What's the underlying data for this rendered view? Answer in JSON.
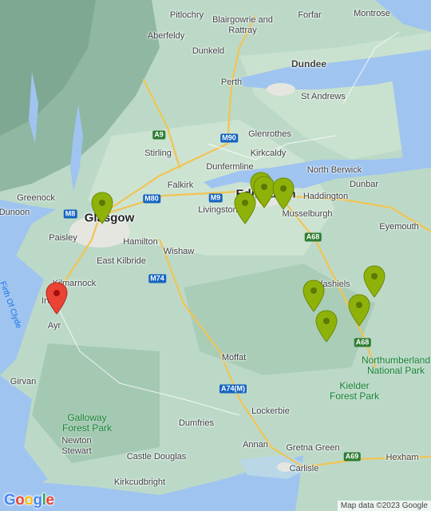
{
  "map": {
    "places": [
      {
        "id": "pitlochry",
        "label": "Pitlochry"
      },
      {
        "id": "blairgowrie",
        "label": "Blairgowrie and Rattray"
      },
      {
        "id": "forfar",
        "label": "Forfar"
      },
      {
        "id": "montrose",
        "label": "Montrose"
      },
      {
        "id": "aberfeldy",
        "label": "Aberfeldy"
      },
      {
        "id": "dunkeld",
        "label": "Dunkeld"
      },
      {
        "id": "dundee",
        "label": "Dundee"
      },
      {
        "id": "perth",
        "label": "Perth"
      },
      {
        "id": "standrews",
        "label": "St Andrews"
      },
      {
        "id": "glenrothes",
        "label": "Glenrothes"
      },
      {
        "id": "stirling",
        "label": "Stirling"
      },
      {
        "id": "kirkcaldy",
        "label": "Kirkcaldy"
      },
      {
        "id": "dunfermline",
        "label": "Dunfermline"
      },
      {
        "id": "northberwick",
        "label": "North Berwick"
      },
      {
        "id": "falkirk",
        "label": "Falkirk"
      },
      {
        "id": "dunbar",
        "label": "Dunbar"
      },
      {
        "id": "greenock",
        "label": "Greenock"
      },
      {
        "id": "edinburgh",
        "label": "Edinburgh"
      },
      {
        "id": "haddington",
        "label": "Haddington"
      },
      {
        "id": "dunoon",
        "label": "Dunoon"
      },
      {
        "id": "glasgow",
        "label": "Glasgow"
      },
      {
        "id": "livingston",
        "label": "Livingston"
      },
      {
        "id": "musselburgh",
        "label": "Musselburgh"
      },
      {
        "id": "paisley",
        "label": "Paisley"
      },
      {
        "id": "hamilton",
        "label": "Hamilton"
      },
      {
        "id": "eyemouth",
        "label": "Eyemouth"
      },
      {
        "id": "wishaw",
        "label": "Wishaw"
      },
      {
        "id": "eastkilbride",
        "label": "East Kilbride"
      },
      {
        "id": "kilmarnock",
        "label": "Kilmarnock"
      },
      {
        "id": "galashiels",
        "label": "Galashiels"
      },
      {
        "id": "irvine",
        "label": "Irv"
      },
      {
        "id": "ayr",
        "label": "Ayr"
      },
      {
        "id": "moffat",
        "label": "Moffat"
      },
      {
        "id": "girvan",
        "label": "Girvan"
      },
      {
        "id": "lockerbie",
        "label": "Lockerbie"
      },
      {
        "id": "dumfries",
        "label": "Dumfries"
      },
      {
        "id": "newtonstewart",
        "label": "Newton Stewart"
      },
      {
        "id": "annan",
        "label": "Annan"
      },
      {
        "id": "gretna",
        "label": "Gretna Green"
      },
      {
        "id": "castledouglas",
        "label": "Castle Douglas"
      },
      {
        "id": "carlisle",
        "label": "Carlisle"
      },
      {
        "id": "hexham",
        "label": "Hexham"
      },
      {
        "id": "kirkcudbright",
        "label": "Kirkcudbright"
      }
    ],
    "water_labels": [
      {
        "id": "firthofclyde",
        "label": "Firth Of Clyde"
      }
    ],
    "park_labels": [
      {
        "id": "northumberland",
        "label": "Northumberland National Park"
      },
      {
        "id": "kielder",
        "label": "Kielder Forest Park"
      },
      {
        "id": "galloway",
        "label": "Galloway Forest Park"
      }
    ],
    "road_shields": [
      {
        "id": "a9",
        "label": "A9",
        "color": "#2e7d32"
      },
      {
        "id": "m90",
        "label": "M90",
        "color": "#1565c0"
      },
      {
        "id": "m80",
        "label": "M80",
        "color": "#1565c0"
      },
      {
        "id": "m9",
        "label": "M9",
        "color": "#1565c0"
      },
      {
        "id": "m8",
        "label": "M8",
        "color": "#1565c0"
      },
      {
        "id": "a68a",
        "label": "A68",
        "color": "#2e7d32"
      },
      {
        "id": "m74",
        "label": "M74",
        "color": "#1565c0"
      },
      {
        "id": "a68b",
        "label": "A68",
        "color": "#2e7d32"
      },
      {
        "id": "a74m",
        "label": "A74(M)",
        "color": "#1565c0"
      },
      {
        "id": "a69",
        "label": "A69",
        "color": "#2e7d32"
      }
    ],
    "markers": {
      "green_count": 9,
      "red_count": 1,
      "green_color": "#8fb20a",
      "red_color": "#ea4335"
    }
  },
  "attribution": "Map data ©2023 Google",
  "logo": {
    "letters": [
      "G",
      "o",
      "o",
      "g",
      "l",
      "e"
    ],
    "colors": [
      "#4285f4",
      "#ea4335",
      "#fbbc05",
      "#4285f4",
      "#34a853",
      "#ea4335"
    ]
  }
}
